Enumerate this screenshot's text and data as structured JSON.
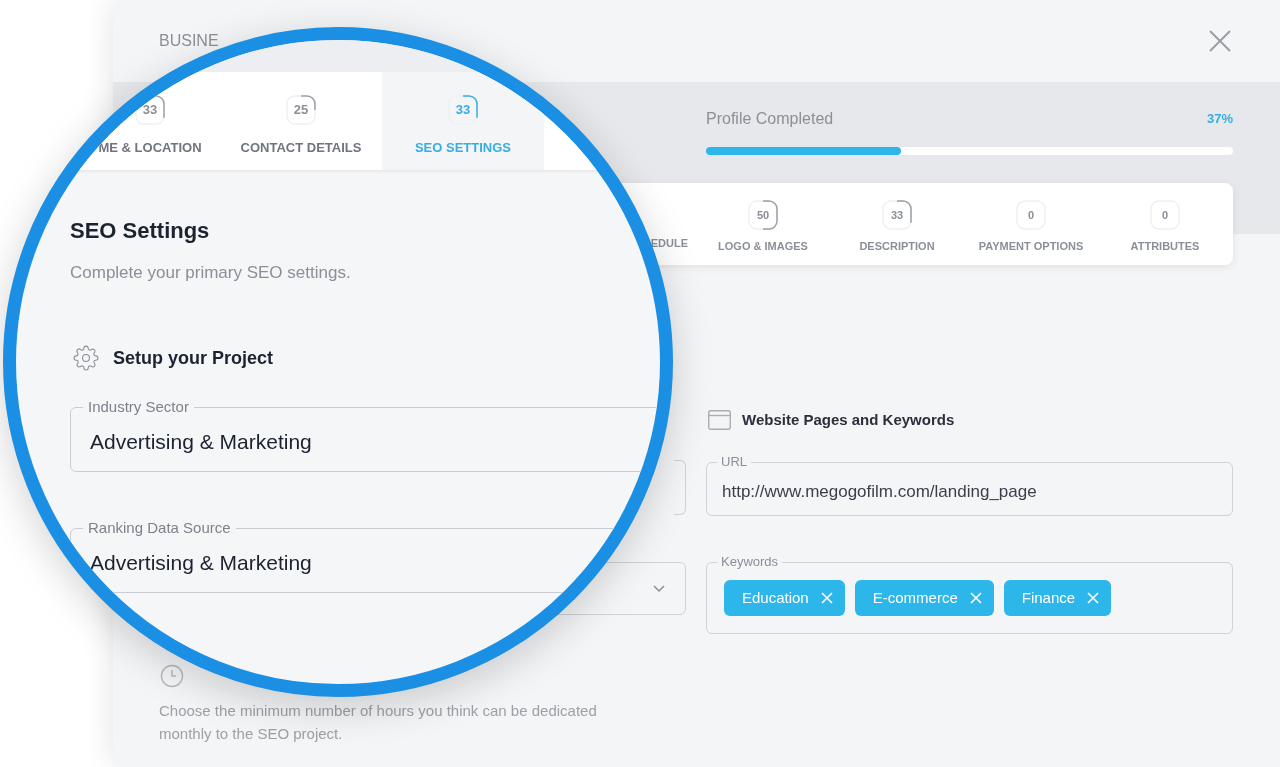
{
  "modal": {
    "title": "BUSINE"
  },
  "progress": {
    "label": "Profile Completed",
    "value": "37%",
    "level": 0.37
  },
  "steps": [
    {
      "label": "EDULE"
    },
    {
      "badge": "50",
      "label": "LOGO & IMAGES"
    },
    {
      "badge": "33",
      "label": "DESCRIPTION"
    },
    {
      "badge": "0",
      "label": "PAYMENT OPTIONS"
    },
    {
      "badge": "0",
      "label": "ATTRIBUTES"
    }
  ],
  "website_section": {
    "title": "Website Pages and Keywords",
    "url_field": {
      "label": "URL",
      "value": "http://www.megogofilm.com/landing_page"
    },
    "keywords_field": {
      "label": "Keywords",
      "chips": [
        "Education",
        "E-commerce",
        "Finance"
      ]
    }
  },
  "hours_section": {
    "description": "Choose the minimum number of hours you think can be dedicated monthly to the SEO project."
  },
  "magnifier": {
    "tabs": [
      {
        "badge": "33",
        "label": "ME & LOCATION",
        "selected": false
      },
      {
        "badge": "25",
        "label": "CONTACT DETAILS",
        "selected": false
      },
      {
        "badge": "33",
        "label": "SEO SETTINGS",
        "selected": true
      }
    ],
    "heading": "SEO Settings",
    "subtitle": "Complete your primary SEO settings.",
    "section_title": "Setup your Project",
    "fields": [
      {
        "label": "Industry Sector",
        "value": "Advertising & Marketing"
      },
      {
        "label": "Ranking Data Source",
        "value": "Advertising & Marketing"
      }
    ]
  }
}
